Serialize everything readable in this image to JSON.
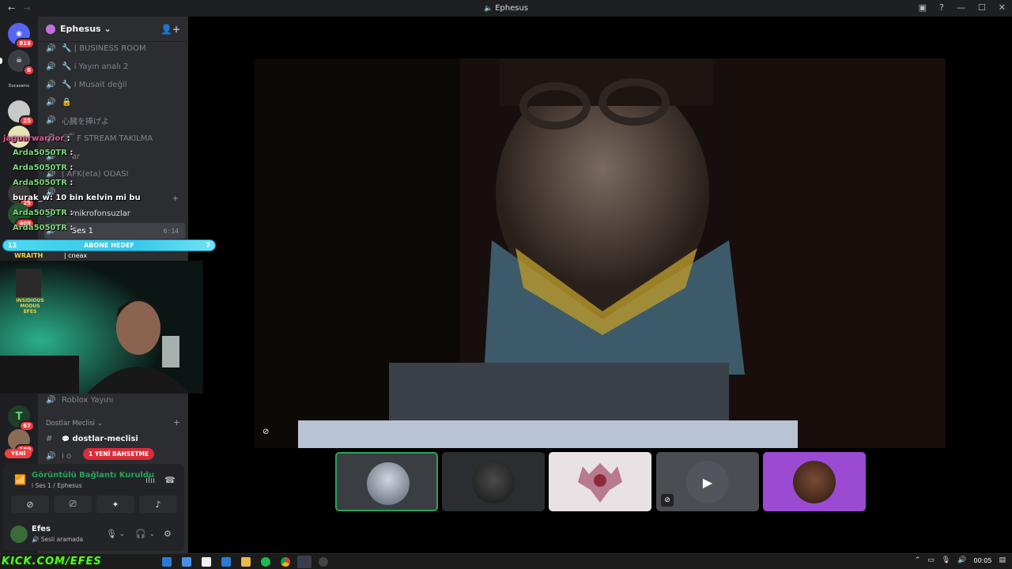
{
  "window": {
    "title": "Ephesus",
    "nav_back": "←",
    "nav_forward": "→"
  },
  "rail": {
    "badges": [
      "816",
      "6",
      "25",
      "25",
      "408",
      "67",
      "180"
    ],
    "label_top": "Ducasamo"
  },
  "server": {
    "name": "Ephesus",
    "chevron": "⌄"
  },
  "channels": [
    {
      "emoji": "🔧",
      "label": "| BUSINESS ROOM"
    },
    {
      "emoji": "🔧",
      "label": "i Yayın analı 2"
    },
    {
      "emoji": "🔧",
      "label": "I Musait değil"
    },
    {
      "emoji": "🔒",
      "label": ""
    },
    {
      "emoji": "",
      "label": "心臓を捧げよ"
    },
    {
      "emoji": "😴",
      "label": "F STREAM TAKILMA"
    },
    {
      "emoji": "",
      "label": "ar"
    },
    {
      "emoji": "",
      "label": "| AFK(eta) ODASI"
    },
    {
      "emoji": "",
      "label": ""
    },
    {
      "emoji": "",
      "label": "10 bin kelvin mi bu"
    },
    {
      "emoji": "",
      "label": "mikrofonsuzlar"
    },
    {
      "emoji": "",
      "label": "Ses 1",
      "time": "6:14"
    }
  ],
  "channels_lower": {
    "roblox": "Roblox Yayını",
    "category": "Dostlar Meclisi",
    "text_channel": "dostlar-meclisi",
    "voice_partial": "i o"
  },
  "voice": {
    "status": "Görüntülü Bağlantı Kuruldu",
    "sub": "i Ses 1 / Ephesus"
  },
  "user": {
    "name": "Efes",
    "status": "Sesli aramada"
  },
  "overlay": {
    "chat": [
      {
        "user": "jaguarwarrior",
        "msg": ":",
        "pink": true
      },
      {
        "user": "Arda5050TR",
        "msg": ":"
      },
      {
        "user": "Arda5050TR",
        "msg": ":"
      },
      {
        "user": "Arda5050TR",
        "msg": ":"
      },
      {
        "user": "burak_w",
        "msg": ": 10 bin kelvin mi bu"
      },
      {
        "user": "Arda5050TR",
        "msg": ":"
      },
      {
        "user": "Arda5050TR",
        "msg": ":"
      }
    ],
    "goal_left": "12",
    "goal_label": "ABONE HEDEF",
    "goal_right": "7",
    "under_goal_user": "WRAITH",
    "under_goal_text": "| cneax",
    "cam_label": "INSIDIOUS MODUS EFES",
    "yeni": "YENİ",
    "bahset": "1 YENİ BAHSETME",
    "kick": "KICK.COM/EFES"
  },
  "taskbar": {
    "clock": "00:05"
  },
  "colors": {
    "accent": "#5865f2",
    "online": "#23a55a",
    "badge": "#f23f43"
  }
}
